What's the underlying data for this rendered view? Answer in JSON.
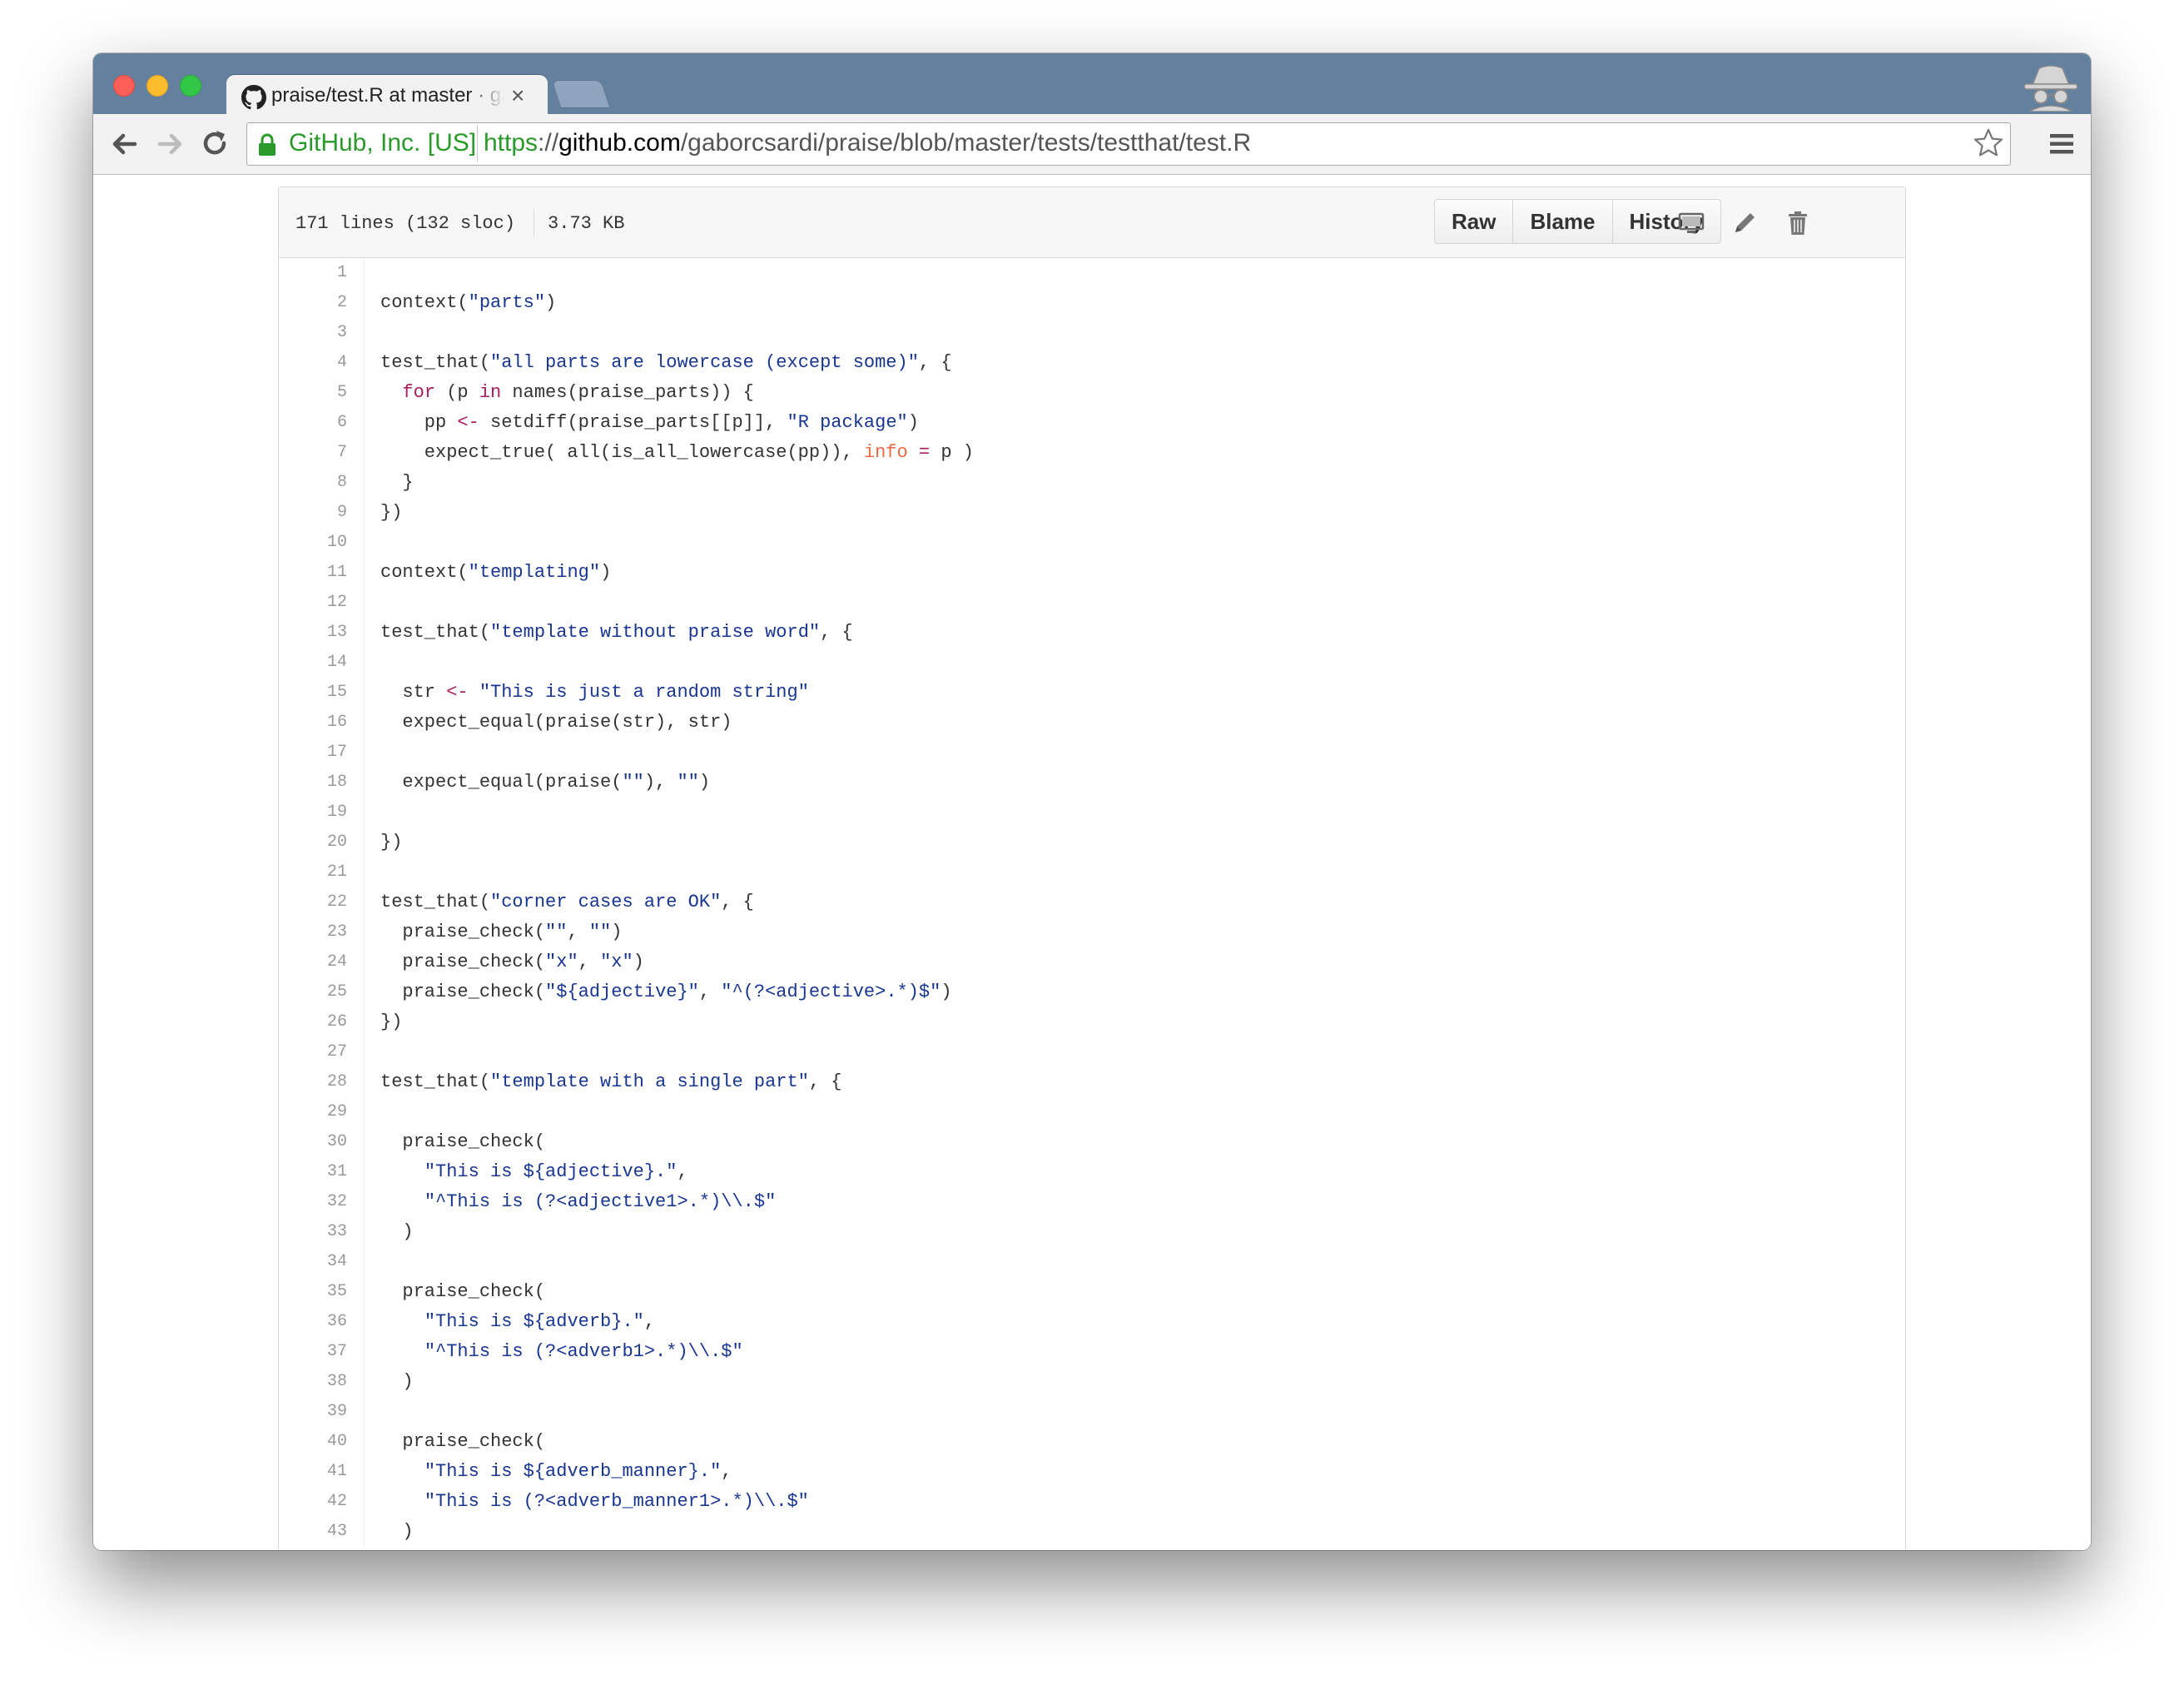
{
  "browser": {
    "tab_title": "praise/test.R at master · gaborcsardi/praise",
    "tab_close": "×",
    "ev_label": "GitHub, Inc. [US]",
    "url_scheme": "https",
    "url_sep": "://",
    "url_host": "github.com",
    "url_path": "/gaborcsardi/praise/blob/master/tests/testthat/test.R",
    "icons": [
      "back-icon",
      "forward-icon",
      "reload-icon",
      "lock-icon",
      "star-icon",
      "menu-icon",
      "incognito-icon",
      "github-icon"
    ]
  },
  "file": {
    "lines_info": "171 lines (132 sloc)",
    "size": "3.73 KB",
    "buttons": {
      "raw": "Raw",
      "blame": "Blame",
      "history": "History"
    },
    "action_icons": [
      "desktop-icon",
      "pencil-icon",
      "trash-icon"
    ]
  },
  "code_lines": [
    {
      "n": "1",
      "tokens": []
    },
    {
      "n": "2",
      "tokens": [
        {
          "t": "p",
          "v": "context("
        },
        {
          "t": "s",
          "v": "\"parts\""
        },
        {
          "t": "p",
          "v": ")"
        }
      ]
    },
    {
      "n": "3",
      "tokens": []
    },
    {
      "n": "4",
      "tokens": [
        {
          "t": "p",
          "v": "test_that("
        },
        {
          "t": "s",
          "v": "\"all parts are lowercase (except some)\""
        },
        {
          "t": "p",
          "v": ", {"
        }
      ]
    },
    {
      "n": "5",
      "tokens": [
        {
          "t": "p",
          "v": "  "
        },
        {
          "t": "k",
          "v": "for"
        },
        {
          "t": "p",
          "v": " (p "
        },
        {
          "t": "k",
          "v": "in"
        },
        {
          "t": "p",
          "v": " names(praise_parts)) {"
        }
      ]
    },
    {
      "n": "6",
      "tokens": [
        {
          "t": "p",
          "v": "    pp "
        },
        {
          "t": "k",
          "v": "<-"
        },
        {
          "t": "p",
          "v": " setdiff(praise_parts[[p]], "
        },
        {
          "t": "s",
          "v": "\"R package\""
        },
        {
          "t": "p",
          "v": ")"
        }
      ]
    },
    {
      "n": "7",
      "tokens": [
        {
          "t": "p",
          "v": "    expect_true( all(is_all_lowercase(pp)), "
        },
        {
          "t": "a",
          "v": "info"
        },
        {
          "t": "p",
          "v": " "
        },
        {
          "t": "k",
          "v": "="
        },
        {
          "t": "p",
          "v": " p )"
        }
      ]
    },
    {
      "n": "8",
      "tokens": [
        {
          "t": "p",
          "v": "  }"
        }
      ]
    },
    {
      "n": "9",
      "tokens": [
        {
          "t": "p",
          "v": "})"
        }
      ]
    },
    {
      "n": "10",
      "tokens": []
    },
    {
      "n": "11",
      "tokens": [
        {
          "t": "p",
          "v": "context("
        },
        {
          "t": "s",
          "v": "\"templating\""
        },
        {
          "t": "p",
          "v": ")"
        }
      ]
    },
    {
      "n": "12",
      "tokens": []
    },
    {
      "n": "13",
      "tokens": [
        {
          "t": "p",
          "v": "test_that("
        },
        {
          "t": "s",
          "v": "\"template without praise word\""
        },
        {
          "t": "p",
          "v": ", {"
        }
      ]
    },
    {
      "n": "14",
      "tokens": []
    },
    {
      "n": "15",
      "tokens": [
        {
          "t": "p",
          "v": "  str "
        },
        {
          "t": "k",
          "v": "<-"
        },
        {
          "t": "p",
          "v": " "
        },
        {
          "t": "s",
          "v": "\"This is just a random string\""
        }
      ]
    },
    {
      "n": "16",
      "tokens": [
        {
          "t": "p",
          "v": "  expect_equal(praise(str), str)"
        }
      ]
    },
    {
      "n": "17",
      "tokens": []
    },
    {
      "n": "18",
      "tokens": [
        {
          "t": "p",
          "v": "  expect_equal(praise("
        },
        {
          "t": "s",
          "v": "\"\""
        },
        {
          "t": "p",
          "v": "), "
        },
        {
          "t": "s",
          "v": "\"\""
        },
        {
          "t": "p",
          "v": ")"
        }
      ]
    },
    {
      "n": "19",
      "tokens": []
    },
    {
      "n": "20",
      "tokens": [
        {
          "t": "p",
          "v": "})"
        }
      ]
    },
    {
      "n": "21",
      "tokens": []
    },
    {
      "n": "22",
      "tokens": [
        {
          "t": "p",
          "v": "test_that("
        },
        {
          "t": "s",
          "v": "\"corner cases are OK\""
        },
        {
          "t": "p",
          "v": ", {"
        }
      ]
    },
    {
      "n": "23",
      "tokens": [
        {
          "t": "p",
          "v": "  praise_check("
        },
        {
          "t": "s",
          "v": "\"\""
        },
        {
          "t": "p",
          "v": ", "
        },
        {
          "t": "s",
          "v": "\"\""
        },
        {
          "t": "p",
          "v": ")"
        }
      ]
    },
    {
      "n": "24",
      "tokens": [
        {
          "t": "p",
          "v": "  praise_check("
        },
        {
          "t": "s",
          "v": "\"x\""
        },
        {
          "t": "p",
          "v": ", "
        },
        {
          "t": "s",
          "v": "\"x\""
        },
        {
          "t": "p",
          "v": ")"
        }
      ]
    },
    {
      "n": "25",
      "tokens": [
        {
          "t": "p",
          "v": "  praise_check("
        },
        {
          "t": "s",
          "v": "\"${adjective}\""
        },
        {
          "t": "p",
          "v": ", "
        },
        {
          "t": "s",
          "v": "\"^(?<adjective>.*)$\""
        },
        {
          "t": "p",
          "v": ")"
        }
      ]
    },
    {
      "n": "26",
      "tokens": [
        {
          "t": "p",
          "v": "})"
        }
      ]
    },
    {
      "n": "27",
      "tokens": []
    },
    {
      "n": "28",
      "tokens": [
        {
          "t": "p",
          "v": "test_that("
        },
        {
          "t": "s",
          "v": "\"template with a single part\""
        },
        {
          "t": "p",
          "v": ", {"
        }
      ]
    },
    {
      "n": "29",
      "tokens": []
    },
    {
      "n": "30",
      "tokens": [
        {
          "t": "p",
          "v": "  praise_check("
        }
      ]
    },
    {
      "n": "31",
      "tokens": [
        {
          "t": "p",
          "v": "    "
        },
        {
          "t": "s",
          "v": "\"This is ${adjective}.\""
        },
        {
          "t": "p",
          "v": ","
        }
      ]
    },
    {
      "n": "32",
      "tokens": [
        {
          "t": "p",
          "v": "    "
        },
        {
          "t": "s",
          "v": "\"^This is (?<adjective1>.*)\\\\.$\""
        }
      ]
    },
    {
      "n": "33",
      "tokens": [
        {
          "t": "p",
          "v": "  )"
        }
      ]
    },
    {
      "n": "34",
      "tokens": []
    },
    {
      "n": "35",
      "tokens": [
        {
          "t": "p",
          "v": "  praise_check("
        }
      ]
    },
    {
      "n": "36",
      "tokens": [
        {
          "t": "p",
          "v": "    "
        },
        {
          "t": "s",
          "v": "\"This is ${adverb}.\""
        },
        {
          "t": "p",
          "v": ","
        }
      ]
    },
    {
      "n": "37",
      "tokens": [
        {
          "t": "p",
          "v": "    "
        },
        {
          "t": "s",
          "v": "\"^This is (?<adverb1>.*)\\\\.$\""
        }
      ]
    },
    {
      "n": "38",
      "tokens": [
        {
          "t": "p",
          "v": "  )"
        }
      ]
    },
    {
      "n": "39",
      "tokens": []
    },
    {
      "n": "40",
      "tokens": [
        {
          "t": "p",
          "v": "  praise_check("
        }
      ]
    },
    {
      "n": "41",
      "tokens": [
        {
          "t": "p",
          "v": "    "
        },
        {
          "t": "s",
          "v": "\"This is ${adverb_manner}.\""
        },
        {
          "t": "p",
          "v": ","
        }
      ]
    },
    {
      "n": "42",
      "tokens": [
        {
          "t": "p",
          "v": "    "
        },
        {
          "t": "s",
          "v": "\"This is (?<adverb_manner1>.*)\\\\.$\""
        }
      ]
    },
    {
      "n": "43",
      "tokens": [
        {
          "t": "p",
          "v": "  )"
        }
      ]
    }
  ],
  "colors": {
    "titlebar": "#64809f",
    "string": "#183691",
    "keyword": "#a71d5d",
    "argument": "#ed6a43",
    "ev_green": "#2a9a2a"
  }
}
